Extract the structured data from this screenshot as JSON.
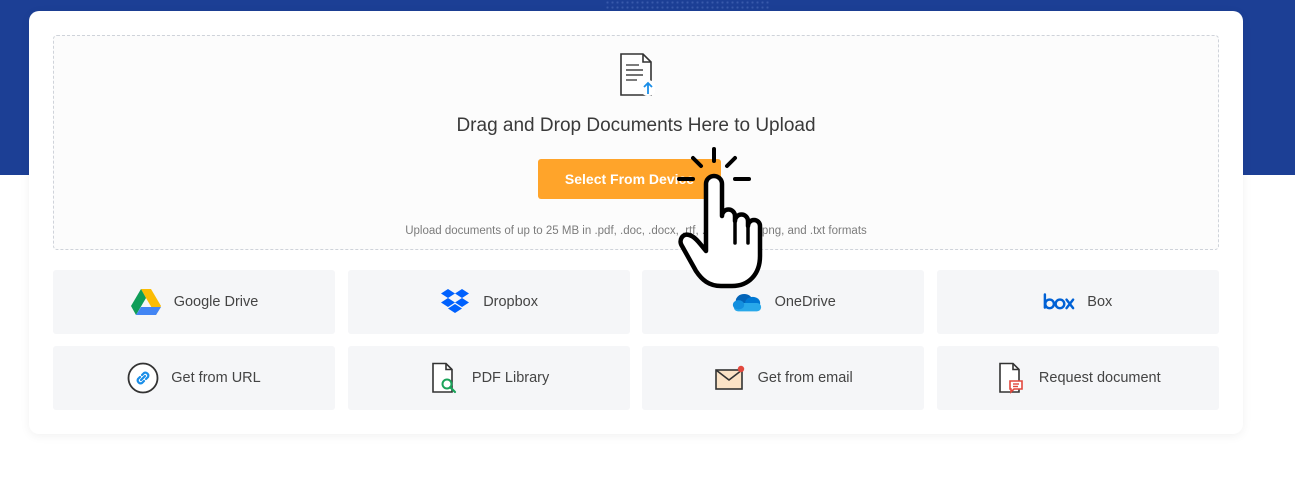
{
  "upload": {
    "title": "Drag and Drop Documents Here to Upload",
    "select_button": "Select From Device",
    "hint": "Upload documents of up to 25 MB in .pdf, .doc, .docx, .rtf, .ppt, .jpeg, .png, and .txt formats"
  },
  "sources": [
    {
      "label": "Google Drive",
      "icon": "google-drive-icon"
    },
    {
      "label": "Dropbox",
      "icon": "dropbox-icon"
    },
    {
      "label": "OneDrive",
      "icon": "onedrive-icon"
    },
    {
      "label": "Box",
      "icon": "box-icon"
    },
    {
      "label": "Get from URL",
      "icon": "link-icon"
    },
    {
      "label": "PDF Library",
      "icon": "pdf-library-icon"
    },
    {
      "label": "Get from email",
      "icon": "email-icon"
    },
    {
      "label": "Request document",
      "icon": "request-document-icon"
    }
  ],
  "colors": {
    "header_band": "#1c3f95",
    "primary_button": "#ffa42a",
    "tile_bg": "#f5f6f8"
  }
}
